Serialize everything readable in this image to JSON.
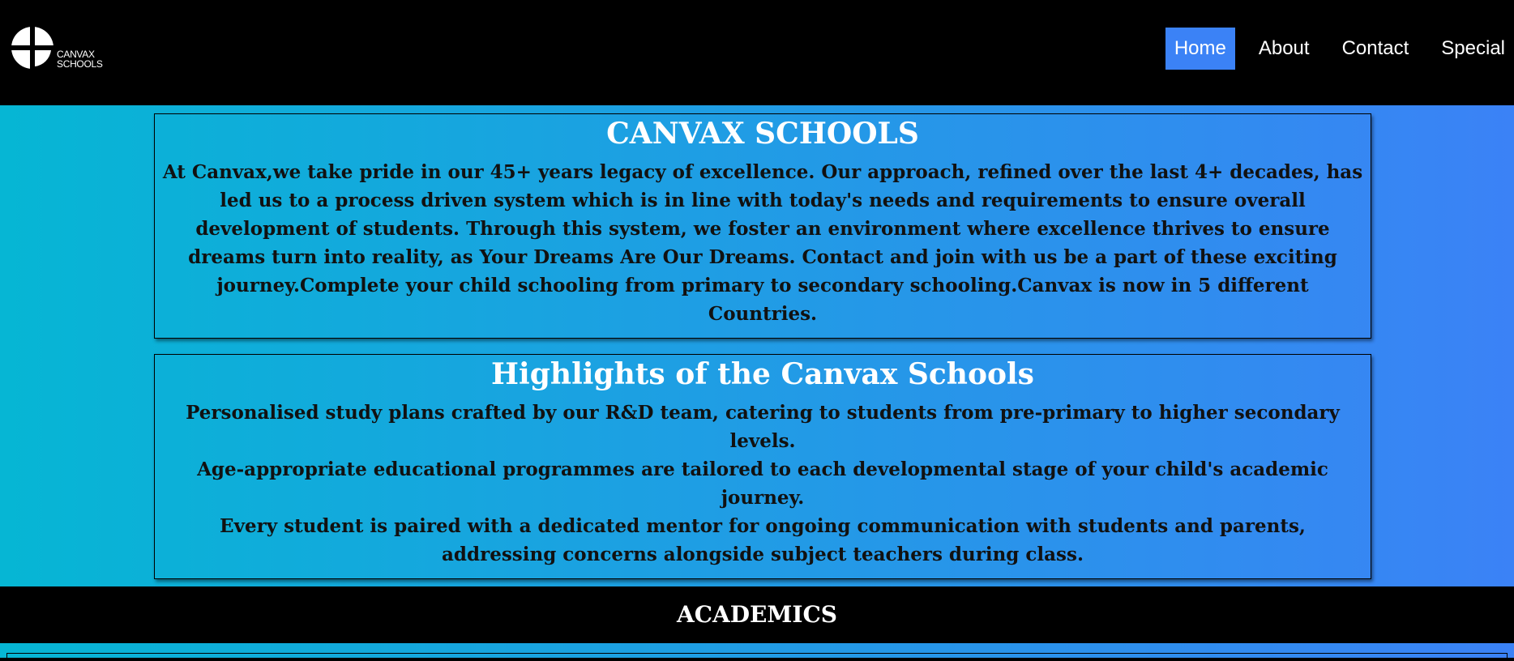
{
  "logo": {
    "line1": "CANVAX",
    "line2": "SCHOOLS"
  },
  "nav": {
    "items": [
      {
        "label": "Home",
        "active": true
      },
      {
        "label": "About",
        "active": false
      },
      {
        "label": "Contact",
        "active": false
      },
      {
        "label": "Special",
        "active": false
      }
    ]
  },
  "intro": {
    "title": "CANVAX SCHOOLS",
    "body": "At Canvax,we take pride in our 45+ years legacy of excellence. Our approach, refined over the last 4+ decades, has led us to a process driven system which is in line with today's needs and requirements to ensure overall development of students. Through this system, we foster an environment where excellence thrives to ensure dreams turn into reality, as Your Dreams Are Our Dreams. Contact and join with us be a part of these exciting journey.Complete your child schooling from primary to secondary schooling.Canvax is now in 5 different Countries."
  },
  "highlights": {
    "title": "Highlights of the Canvax Schools",
    "items": [
      "Personalised study plans crafted by our R&D team, catering to students from pre-primary to higher secondary levels.",
      "Age-appropriate educational programmes are tailored to each developmental stage of your child's academic journey.",
      "Every student is paired with a dedicated mentor for ongoing communication with students and parents, addressing concerns alongside subject teachers during class."
    ]
  },
  "academics": {
    "title": "ACADEMICS"
  },
  "colors": {
    "gradient_start": "#06b6d4",
    "gradient_end": "#3b82f6",
    "nav_active": "#3b82f6"
  },
  "icons": {
    "logo": "canvax-logo-icon"
  }
}
